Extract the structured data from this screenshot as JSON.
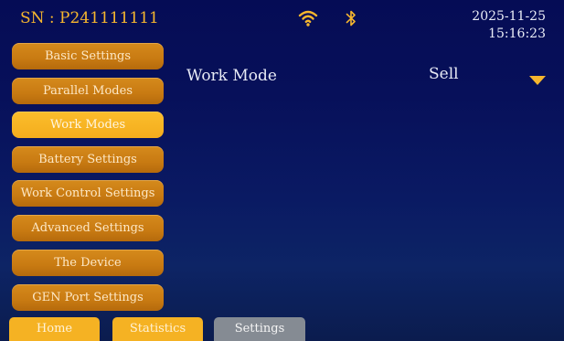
{
  "header": {
    "serial": "SN : P241111111",
    "date": "2025-11-25",
    "time": "15:16:23",
    "icons": [
      "wifi-icon",
      "bluetooth-icon"
    ]
  },
  "sidebar": {
    "items": [
      {
        "label": "Basic Settings",
        "active": false
      },
      {
        "label": "Parallel Modes",
        "active": false
      },
      {
        "label": "Work Modes",
        "active": true
      },
      {
        "label": "Battery Settings",
        "active": false
      },
      {
        "label": "Work Control Settings",
        "active": false
      },
      {
        "label": "Advanced Settings",
        "active": false
      },
      {
        "label": "The Device",
        "active": false
      },
      {
        "label": "GEN Port Settings",
        "active": false
      }
    ]
  },
  "main": {
    "work_mode_label": "Work Mode",
    "work_mode_value": "Sell",
    "dropdown_icon": "chevron-down-icon"
  },
  "bottom_nav": {
    "tabs": [
      {
        "label": "Home",
        "active": false
      },
      {
        "label": "Statistics",
        "active": false
      },
      {
        "label": "Settings",
        "active": true
      }
    ]
  },
  "colors": {
    "accent": "#f5b223",
    "menu_item": "#c87a12",
    "active_tab": "#858b93",
    "background": "#07105a"
  }
}
